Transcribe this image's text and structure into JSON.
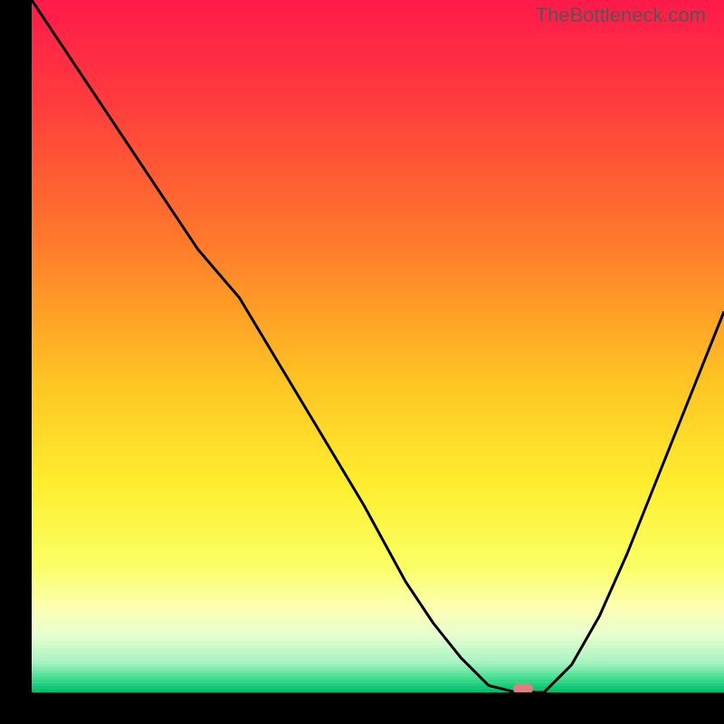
{
  "watermark": "TheBottleneck.com",
  "chart_data": {
    "type": "line",
    "title": "",
    "xlabel": "",
    "ylabel": "",
    "xlim": [
      0,
      100
    ],
    "ylim": [
      0,
      100
    ],
    "x": [
      0,
      6,
      12,
      18,
      24,
      30,
      36,
      42,
      48,
      54,
      58,
      62,
      66,
      70,
      74,
      78,
      82,
      86,
      90,
      94,
      100
    ],
    "y": [
      100,
      91,
      82,
      73,
      64,
      57,
      47,
      37,
      27,
      16,
      10,
      5,
      1,
      0,
      0,
      4,
      11,
      20,
      30,
      40,
      55
    ],
    "marker": {
      "x": 71,
      "y": 0.5
    },
    "gradient_stops": [
      {
        "pct": 0,
        "color": "#ff1a4a"
      },
      {
        "pct": 15,
        "color": "#ff3d3d"
      },
      {
        "pct": 35,
        "color": "#ff7a2b"
      },
      {
        "pct": 55,
        "color": "#ffc423"
      },
      {
        "pct": 70,
        "color": "#ffee2f"
      },
      {
        "pct": 82,
        "color": "#fbff65"
      },
      {
        "pct": 88,
        "color": "#fdffb3"
      },
      {
        "pct": 92,
        "color": "#e6ffd0"
      },
      {
        "pct": 96,
        "color": "#a6f2c1"
      },
      {
        "pct": 98,
        "color": "#4adf93"
      },
      {
        "pct": 100,
        "color": "#00c06c"
      }
    ]
  }
}
